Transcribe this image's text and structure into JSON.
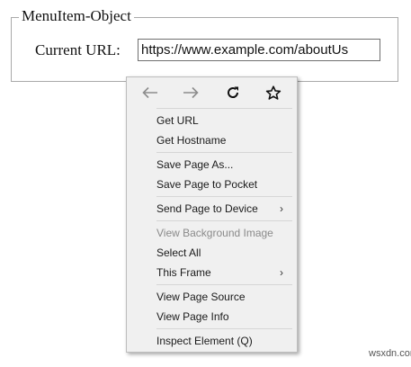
{
  "form": {
    "legend": "MenuItem-Object",
    "url_label": "Current URL:",
    "url_value": "https://www.example.com/aboutUs"
  },
  "context_menu": {
    "nav": [
      {
        "name": "back-icon"
      },
      {
        "name": "forward-icon"
      },
      {
        "name": "reload-icon"
      },
      {
        "name": "bookmark-star-icon"
      }
    ],
    "items": [
      {
        "label": "Get URL"
      },
      {
        "label": "Get Hostname"
      },
      {
        "label": "Save Page As..."
      },
      {
        "label": "Save Page to Pocket"
      },
      {
        "label": "Send Page to Device",
        "submenu": "›"
      },
      {
        "label": "View Background Image",
        "disabled": true
      },
      {
        "label": "Select All"
      },
      {
        "label": "This Frame",
        "submenu": "›"
      },
      {
        "label": "View Page Source"
      },
      {
        "label": "View Page Info"
      },
      {
        "label": "Inspect Element (Q)"
      }
    ]
  },
  "watermark": "wsxdn.com",
  "colors": {
    "menu_background": "#f0f0f0",
    "disabled_text": "#8a8a8a",
    "separator": "#d6d6d6"
  }
}
